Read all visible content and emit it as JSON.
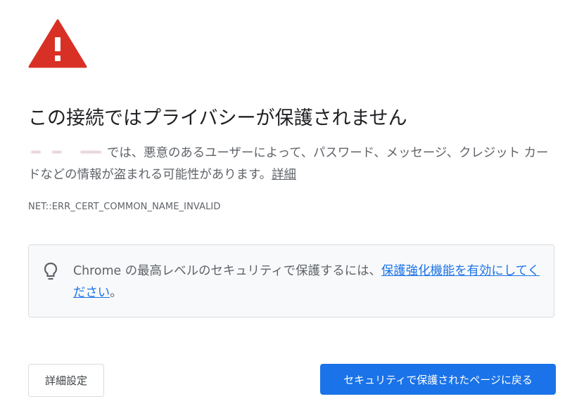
{
  "colors": {
    "warning_red": "#d93025",
    "primary_blue": "#1a73e8",
    "text_dark": "#202124",
    "text_gray": "#5f6368",
    "box_background": "#f8f9fa"
  },
  "header": {
    "icon": "warning-triangle-icon",
    "title": "この接続ではプライバシーが保護されません"
  },
  "message": {
    "text": "では、悪意のあるユーザーによって、パスワード、メッセージ、クレジット カードなどの情報が盗まれる可能性があります。",
    "details_link": "詳細"
  },
  "error_code": "NET::ERR_CERT_COMMON_NAME_INVALID",
  "enhanced_protection": {
    "icon": "lightbulb-icon",
    "text": "Chrome の最高レベルのセキュリティで保護するには、",
    "link": "保護強化機能を有効にしてください",
    "suffix": "。"
  },
  "buttons": {
    "advanced": "詳細設定",
    "back_to_safety": "セキュリティで保護されたページに戻る"
  }
}
